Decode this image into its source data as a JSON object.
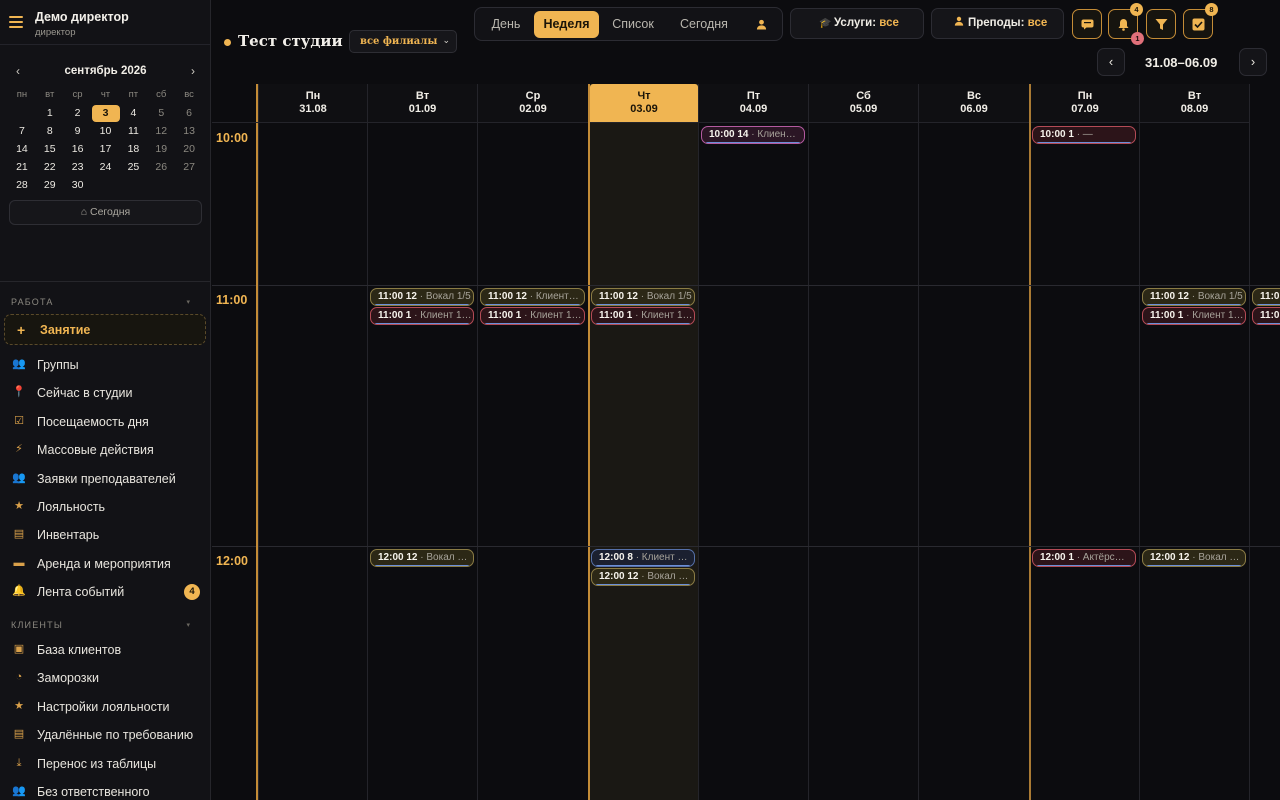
{
  "profile": {
    "name": "Демо директор",
    "role": "директор"
  },
  "mini_calendar": {
    "month_title": "сентябрь 2026",
    "prev": "‹",
    "next": "›",
    "weekdays": [
      "пн",
      "вт",
      "ср",
      "чт",
      "пт",
      "сб",
      "вс"
    ],
    "days": [
      "",
      "1",
      "2",
      "3",
      "4",
      "5",
      "6",
      "7",
      "8",
      "9",
      "10",
      "11",
      "12",
      "13",
      "14",
      "15",
      "16",
      "17",
      "18",
      "19",
      "20",
      "21",
      "22",
      "23",
      "24",
      "25",
      "26",
      "27",
      "28",
      "29",
      "30"
    ],
    "today": "3",
    "today_button": "⌂ Сегодня"
  },
  "sections": {
    "work": "РАБОТА",
    "clients": "КЛИЕНТЫ"
  },
  "new_lesson": {
    "plus": "+",
    "label": "Занятие"
  },
  "nav_work": [
    {
      "label": "Группы",
      "icon": "group-icon"
    },
    {
      "label": "Сейчас в студии",
      "icon": "pin-icon"
    },
    {
      "label": "Посещаемость дня",
      "icon": "check-box-icon"
    },
    {
      "label": "Массовые действия",
      "icon": "lightning-icon"
    },
    {
      "label": "Заявки преподавателей",
      "icon": "group-icon"
    },
    {
      "label": "Лояльность",
      "icon": "star-icon"
    },
    {
      "label": "Инвентарь",
      "icon": "document-icon"
    },
    {
      "label": "Аренда и мероприятия",
      "icon": "card-icon"
    },
    {
      "label": "Лента событий",
      "icon": "bell-icon",
      "badge": "4"
    }
  ],
  "nav_clients": [
    {
      "label": "База клиентов",
      "icon": "id-card-icon"
    },
    {
      "label": "Заморозки",
      "icon": "clock-icon"
    },
    {
      "label": "Настройки лояльности",
      "icon": "star-icon"
    },
    {
      "label": "Удалённые по требованию",
      "icon": "document-icon"
    },
    {
      "label": "Перенос из таблицы",
      "icon": "download-icon"
    },
    {
      "label": "Без ответственного",
      "icon": "group-icon"
    }
  ],
  "topbar": {
    "studio_name": "Тест студии",
    "branch_select": "все филиалы",
    "views": [
      "День",
      "Неделя",
      "Список",
      "Сегодня"
    ],
    "active_view": "Неделя",
    "services_label": "Услуги:",
    "services_value": "все",
    "teachers_label": "Преподы:",
    "teachers_value": "все",
    "notif_count": "4",
    "notif_alert": "1",
    "tasks_count": "8",
    "range_label": "31.08–06.09",
    "range_prev": "‹",
    "range_next": "›"
  },
  "calendar": {
    "hours": [
      "10:00",
      "11:00",
      "12:00"
    ],
    "days": [
      {
        "dow": "Пн",
        "date": "31.08"
      },
      {
        "dow": "Вт",
        "date": "01.09"
      },
      {
        "dow": "Ср",
        "date": "02.09"
      },
      {
        "dow": "Чт",
        "date": "03.09"
      },
      {
        "dow": "Пт",
        "date": "04.09"
      },
      {
        "dow": "Сб",
        "date": "05.09"
      },
      {
        "dow": "Вс",
        "date": "06.09"
      },
      {
        "dow": "Пн",
        "date": "07.09"
      },
      {
        "dow": "Вт",
        "date": "08.09"
      }
    ],
    "events": [
      {
        "day": 4,
        "slot": 0,
        "row": 0,
        "time": "10:00 14",
        "desc": " · Клиен…",
        "style": "pink"
      },
      {
        "day": 7,
        "slot": 0,
        "row": 0,
        "time": "10:00 1",
        "desc": " · —",
        "style": "red"
      },
      {
        "day": 1,
        "slot": 1,
        "row": 0,
        "time": "11:00 12",
        "desc": " · Вокал 1/5",
        "style": "gold"
      },
      {
        "day": 1,
        "slot": 1,
        "row": 1,
        "time": "11:00 1",
        "desc": " · Клиент 1…",
        "style": "red"
      },
      {
        "day": 2,
        "slot": 1,
        "row": 0,
        "time": "11:00 12",
        "desc": " · Клиент…",
        "style": "gold"
      },
      {
        "day": 2,
        "slot": 1,
        "row": 1,
        "time": "11:00 1",
        "desc": " · Клиент 1…",
        "style": "red"
      },
      {
        "day": 3,
        "slot": 1,
        "row": 0,
        "time": "11:00 12",
        "desc": " · Вокал 1/5",
        "style": "gold"
      },
      {
        "day": 3,
        "slot": 1,
        "row": 1,
        "time": "11:00 1",
        "desc": " · Клиент 1…",
        "style": "red"
      },
      {
        "day": 8,
        "slot": 1,
        "row": 0,
        "time": "11:00 12",
        "desc": " · Вокал 1/5",
        "style": "gold"
      },
      {
        "day": 8,
        "slot": 1,
        "row": 1,
        "time": "11:00 1",
        "desc": " · Клиент 1…",
        "style": "red"
      },
      {
        "day": 9,
        "slot": 1,
        "row": 0,
        "time": "11:0",
        "desc": "",
        "style": "gold"
      },
      {
        "day": 9,
        "slot": 1,
        "row": 1,
        "time": "11:0",
        "desc": "",
        "style": "red"
      },
      {
        "day": 1,
        "slot": 2,
        "row": 0,
        "time": "12:00 12",
        "desc": " · Вокал …",
        "style": "gold"
      },
      {
        "day": 3,
        "slot": 2,
        "row": 0,
        "time": "12:00 8",
        "desc": " · Клиент …",
        "style": "blue"
      },
      {
        "day": 3,
        "slot": 2,
        "row": 1,
        "time": "12:00 12",
        "desc": " · Вокал …",
        "style": "gold"
      },
      {
        "day": 7,
        "slot": 2,
        "row": 0,
        "time": "12:00 1",
        "desc": " · Актёрс…",
        "style": "red"
      },
      {
        "day": 8,
        "slot": 2,
        "row": 0,
        "time": "12:00 12",
        "desc": " · Вокал …",
        "style": "gold"
      }
    ]
  }
}
